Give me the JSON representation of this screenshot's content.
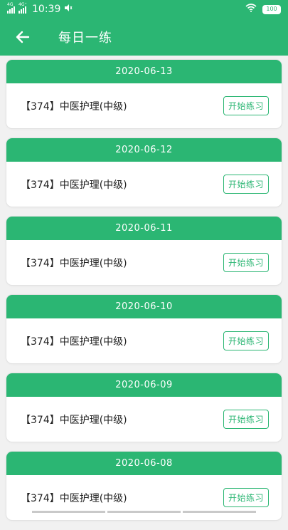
{
  "status": {
    "time": "10:39",
    "battery": "100",
    "net1": "4G",
    "net2": "4G⁺"
  },
  "header": {
    "title": "每日一练"
  },
  "practice": {
    "items": [
      {
        "date": "2020-06-13",
        "title": "【374】中医护理(中级)",
        "button": "开始练习"
      },
      {
        "date": "2020-06-12",
        "title": "【374】中医护理(中级)",
        "button": "开始练习"
      },
      {
        "date": "2020-06-11",
        "title": "【374】中医护理(中级)",
        "button": "开始练习"
      },
      {
        "date": "2020-06-10",
        "title": "【374】中医护理(中级)",
        "button": "开始练习"
      },
      {
        "date": "2020-06-09",
        "title": "【374】中医护理(中级)",
        "button": "开始练习"
      },
      {
        "date": "2020-06-08",
        "title": "【374】中医护理(中级)",
        "button": "开始练习"
      }
    ]
  },
  "colors": {
    "brand": "#2bb673",
    "background": "#f1f1f1"
  }
}
